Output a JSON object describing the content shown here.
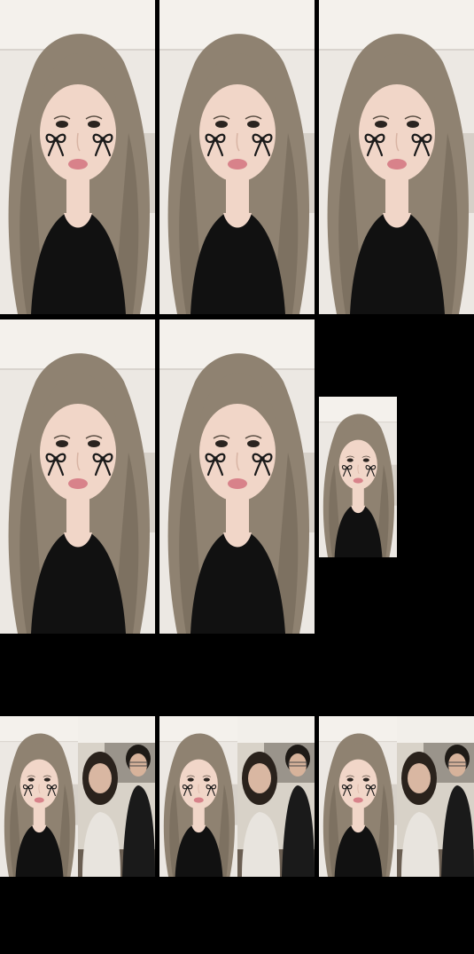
{
  "screen": {
    "background": "#000000"
  },
  "grid": {
    "row1": [
      {
        "name": "video-tile-1",
        "effect": "bow-cheek-stickers"
      },
      {
        "name": "video-tile-2",
        "effect": "bow-cheek-stickers"
      },
      {
        "name": "video-tile-3",
        "effect": "bow-cheek-stickers"
      }
    ],
    "row2": [
      {
        "name": "video-tile-4",
        "effect": "bow-cheek-stickers"
      },
      {
        "name": "video-tile-5",
        "effect": "bow-cheek-stickers"
      },
      {
        "name": "video-tile-6-small",
        "effect": "bow-cheek-stickers"
      }
    ],
    "row3": [
      {
        "name": "video-tile-7-split",
        "effect": "bow-cheek-stickers"
      },
      {
        "name": "video-tile-8-split",
        "effect": "bow-cheek-stickers"
      },
      {
        "name": "video-tile-9-split",
        "effect": "bow-cheek-stickers"
      }
    ]
  },
  "colors": {
    "wall": "#ece8e3",
    "ceiling": "#f4f1ec",
    "hair": "#8f8271",
    "hair_dark": "#6b5f51",
    "skin": "#f1d6c8",
    "shirt": "#111111",
    "lips": "#d8828a",
    "bow": "#1a1a1a",
    "divider": "#000000"
  }
}
